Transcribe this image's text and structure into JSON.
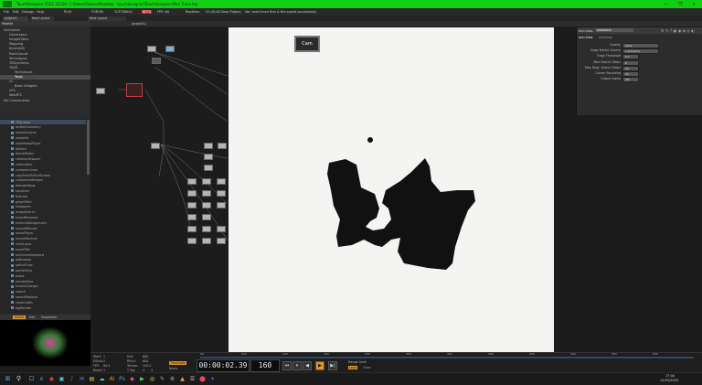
{
  "window": {
    "title": "TouchDesigner 2022.32120: C:/Users/Owner/Desktop - touchdesigner/Touchdesigner-Mad Trace.toe",
    "min_glyph": "—",
    "max_glyph": "❐",
    "close_glyph": "✕"
  },
  "menu": {
    "items": [
      "File",
      "Edit",
      "Dialogs",
      "Help",
      "PLAY",
      "FORUM",
      "TUTORIALS",
      "BETA",
      "FPS: 60",
      "Realtime",
      "22:40:48 Save Project",
      "Ver: mad trace first & the saved successfully"
    ]
  },
  "tabs": {
    "project": "project1",
    "new_layout": "New Layout"
  },
  "sidebar": {
    "header": "Palette",
    "items": [
      {
        "label": "Derivative",
        "indent": 0
      },
      {
        "label": "Generators",
        "indent": 1
      },
      {
        "label": "ImageFilters",
        "indent": 1
      },
      {
        "label": "Mapping",
        "indent": 1
      },
      {
        "label": "Kinect/AR",
        "indent": 1
      },
      {
        "label": "PointClouds",
        "indent": 1
      },
      {
        "label": "Techniques",
        "indent": 1
      },
      {
        "label": "TDSynthesis",
        "indent": 1
      },
      {
        "label": "TDVR",
        "indent": 1
      },
      {
        "label": "Techniques",
        "indent": 2
      },
      {
        "label": "Tools",
        "indent": 2,
        "selected": true
      },
      {
        "label": "UI",
        "indent": 1
      },
      {
        "label": "Basic Widgets",
        "indent": 2
      },
      {
        "label": "VFX",
        "indent": 1
      },
      {
        "label": "WebRTC",
        "indent": 1
      },
      {
        "label": "My Components",
        "indent": 0
      }
    ]
  },
  "oplist": {
    "items": [
      "TDScopes",
      "arcBallGeometry",
      "audioAnalysis",
      "audioSet",
      "autoMediaPlayer",
      "bitSens",
      "blendModes",
      "cameraViewport",
      "chromaKey",
      "compareComp",
      "copyPaintToTextStream",
      "customizeWindow",
      "debugDebug",
      "equalizer",
      "fixScale",
      "graphFilter",
      "histogram",
      "imageSearch",
      "kinectRecorder",
      "materialDesignIcons",
      "mouseBlender",
      "movePlayer",
      "movieMachine",
      "multiLayer",
      "noiseTRN",
      "onScreenKeyboard",
      "opBrowser",
      "opticalFlow",
      "particleSys",
      "probe",
      "remoteFace",
      "screenChanger",
      "search",
      "searchReplace",
      "showCodes",
      "tagRender"
    ]
  },
  "preview_tabs": [
    "Active",
    "Info",
    "Snapshots"
  ],
  "netbar": {
    "path": "/project1/"
  },
  "viewer": {
    "node_label": "Cam"
  },
  "params": {
    "title": "Anti Alias",
    "name": "antialias1",
    "tabs": [
      "Anti Alias",
      "Common"
    ],
    "rows": [
      {
        "label": "Quality",
        "value": "Ultra"
      },
      {
        "label": "Edge Detect Source",
        "value": "Luminance"
      },
      {
        "label": "Edge Threshold",
        "value": "0.1"
      },
      {
        "label": "Max Search Steps",
        "value": "8"
      },
      {
        "label": "Max Diag. Search Steps",
        "value": "16"
      },
      {
        "label": "Corner Rounding",
        "value": "25"
      },
      {
        "label": "Output Alpha",
        "value": "Off"
      }
    ]
  },
  "timeline": {
    "info": [
      "Start:",
      "1",
      "End:",
      "600",
      "RStart:",
      "1",
      "REnd:",
      "600",
      "FPS:",
      "60.0",
      "Tempo:",
      "120.0",
      "Reset:",
      "1",
      "T Sig:",
      "4",
      "4"
    ],
    "ruler_marks": [
      "50",
      "100",
      "150",
      "200",
      "250",
      "300",
      "350",
      "400",
      "450",
      "500",
      "550",
      "600"
    ],
    "timecode": "00:00:02.39",
    "fps": "160",
    "range_label": "Range Limit",
    "loop": "Loop",
    "once": "Once",
    "timecode_mode": "TimeCode",
    "beats": "Beats"
  },
  "taskbar": {
    "start": "⊞",
    "search": "⚲",
    "time": "17:40",
    "date": "11/05/2023",
    "icons": [
      "☐",
      "e",
      "◉",
      "▣",
      "♪",
      "✉",
      "▤",
      "☁",
      "Ai",
      "Ps",
      "◆",
      "▶",
      "◎",
      "✎",
      "⚙",
      "▲",
      "☰",
      "⬤",
      "✦"
    ]
  },
  "colors": {
    "titlebar": "#11d011",
    "viewer_bg": "#f4f4f2",
    "blob": "#111111",
    "accent_orange": "#e0962a"
  }
}
